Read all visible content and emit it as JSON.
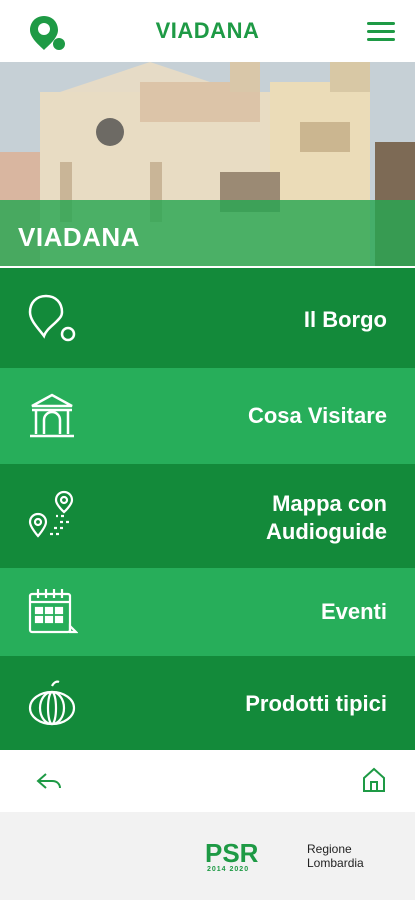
{
  "header": {
    "title": "VIADANA",
    "logo_icon": "location-pin-icon",
    "menu_icon": "hamburger-menu-icon"
  },
  "hero": {
    "label": "VIADANA"
  },
  "colors": {
    "brand_green": "#1e9a45",
    "dark_green": "#138a3a",
    "light_green": "#27ae5a"
  },
  "menu": [
    {
      "label": "Il Borgo",
      "icon": "location-pin-icon"
    },
    {
      "label": "Cosa Visitare",
      "icon": "temple-icon"
    },
    {
      "label": "Mappa con Audioguide",
      "line1": "Mappa con",
      "line2": "Audioguide",
      "icon": "map-route-icon"
    },
    {
      "label": "Eventi",
      "icon": "calendar-icon"
    },
    {
      "label": "Prodotti tipici",
      "icon": "pumpkin-icon"
    }
  ],
  "bottom_nav": {
    "back_icon": "back-arrow-icon",
    "home_icon": "home-icon"
  },
  "footer": {
    "psr_text": "PSR",
    "psr_years": "2014 2020",
    "lombardia_line1": "Regione",
    "lombardia_line2": "Lombardia"
  }
}
